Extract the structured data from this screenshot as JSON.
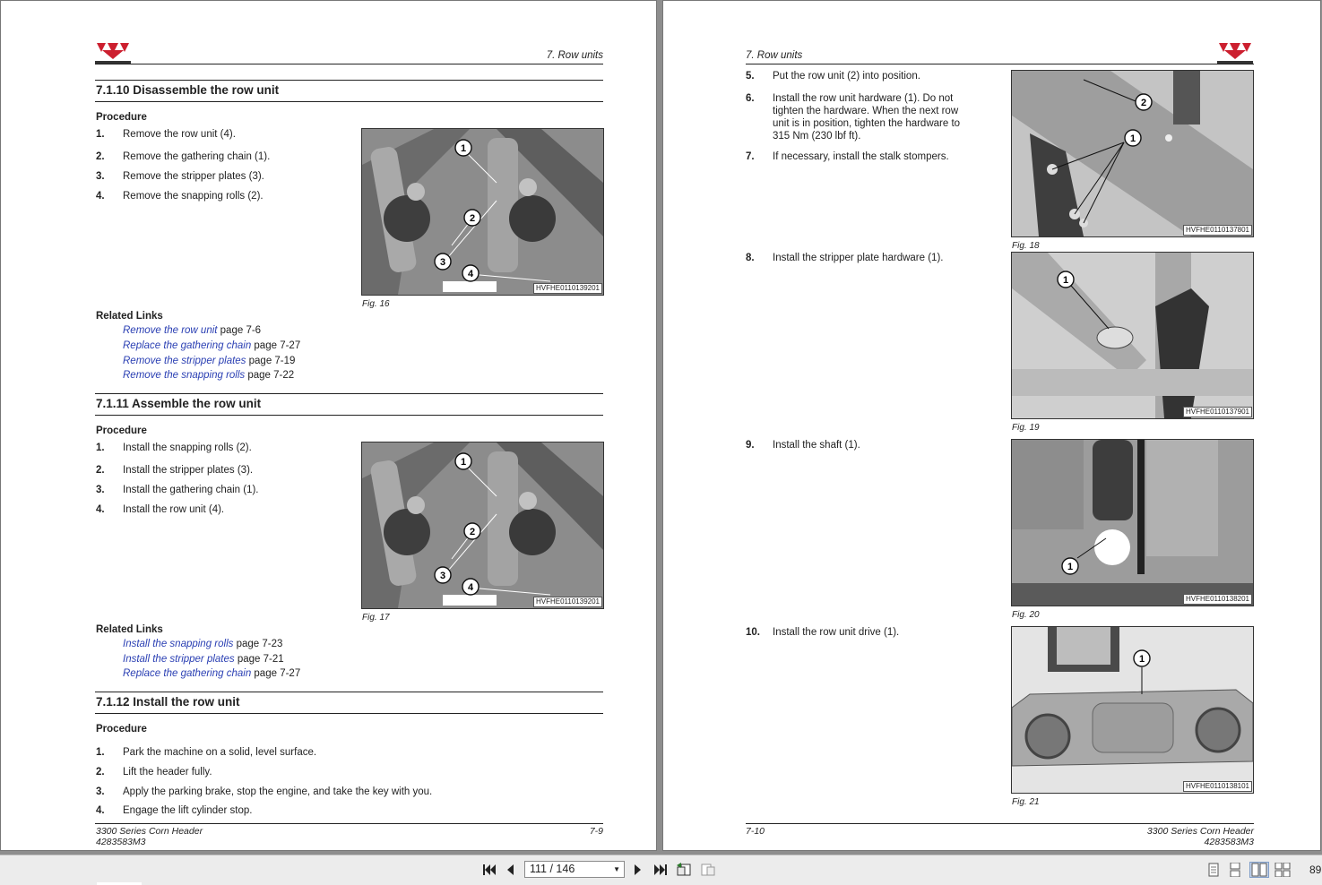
{
  "left_page": {
    "running_head": "7. Row units",
    "s1": {
      "title": "7.1.10  Disassemble the row unit",
      "procedure": "Procedure",
      "steps": [
        {
          "n": "1.",
          "t": "Remove the row unit (4)."
        },
        {
          "n": "2.",
          "t": "Remove the gathering chain (1)."
        },
        {
          "n": "3.",
          "t": "Remove the stripper plates (3)."
        },
        {
          "n": "4.",
          "t": "Remove the snapping rolls (2)."
        }
      ],
      "fig_code": "HVFHE0110139201",
      "fig_caption": "Fig. 16",
      "callouts": [
        "1",
        "2",
        "3",
        "4"
      ],
      "related": "Related Links",
      "links": [
        {
          "text": "Remove the row unit",
          "page": " page 7-6"
        },
        {
          "text": "Replace the gathering chain",
          "page": " page 7-27"
        },
        {
          "text": "Remove the stripper plates",
          "page": " page 7-19"
        },
        {
          "text": "Remove the snapping rolls",
          "page": " page 7-22"
        }
      ]
    },
    "s2": {
      "title": "7.1.11  Assemble the row unit",
      "procedure": "Procedure",
      "steps": [
        {
          "n": "1.",
          "t": "Install the snapping rolls (2)."
        },
        {
          "n": "2.",
          "t": "Install the stripper plates (3)."
        },
        {
          "n": "3.",
          "t": "Install the gathering chain (1)."
        },
        {
          "n": "4.",
          "t": "Install the row unit (4)."
        }
      ],
      "fig_code": "HVFHE0110139201",
      "fig_caption": "Fig. 17",
      "callouts": [
        "1",
        "2",
        "3",
        "4"
      ],
      "related": "Related Links",
      "links": [
        {
          "text": "Install the snapping rolls",
          "page": " page 7-23"
        },
        {
          "text": "Install the stripper plates",
          "page": " page 7-21"
        },
        {
          "text": "Replace the gathering chain",
          "page": " page 7-27"
        }
      ]
    },
    "s3": {
      "title": "7.1.12  Install the row unit",
      "procedure": "Procedure",
      "steps": [
        {
          "n": "1.",
          "t": "Park the machine on a solid, level surface."
        },
        {
          "n": "2.",
          "t": "Lift the header fully."
        },
        {
          "n": "3.",
          "t": "Apply the parking brake, stop the engine, and take the key with you."
        },
        {
          "n": "4.",
          "t": "Engage the lift cylinder stop."
        }
      ]
    },
    "footer_title": "3300 Series Corn Header",
    "footer_code": "4283583M3",
    "page_number": "7-9"
  },
  "right_page": {
    "running_head": "7. Row units",
    "steps": [
      {
        "n": "5.",
        "t": "Put the row unit (2) into position."
      },
      {
        "n": "6.",
        "t": "Install the row unit hardware (1). Do not tighten the hardware. When the next row unit is in position, tighten the hardware to 315 Nm (230 lbf ft)."
      },
      {
        "n": "7.",
        "t": "If necessary, install the stalk stompers."
      },
      {
        "n": "8.",
        "t": "Install the stripper plate hardware (1)."
      },
      {
        "n": "9.",
        "t": "Install the shaft (1)."
      },
      {
        "n": "10.",
        "t": "Install the row unit drive (1)."
      }
    ],
    "figs": [
      {
        "code": "HVFHE0110137801",
        "caption": "Fig. 18",
        "callouts": [
          "2",
          "1"
        ]
      },
      {
        "code": "HVFHE0110137901",
        "caption": "Fig. 19",
        "callouts": [
          "1"
        ]
      },
      {
        "code": "HVFHE0110138201",
        "caption": "Fig. 20",
        "callouts": [
          "1"
        ]
      },
      {
        "code": "HVFHE0110138101",
        "caption": "Fig. 21",
        "callouts": [
          "1"
        ]
      }
    ],
    "page_number": "7-10",
    "footer_title": "3300 Series Corn Header",
    "footer_code": "4283583M3"
  },
  "toolbar": {
    "page_indicator": "111 / 146",
    "zoom": "89"
  },
  "colors": {
    "link": "#2a3fb3",
    "brand_red": "#cc1f2f",
    "viewer_bg": "#8e8e8e"
  }
}
